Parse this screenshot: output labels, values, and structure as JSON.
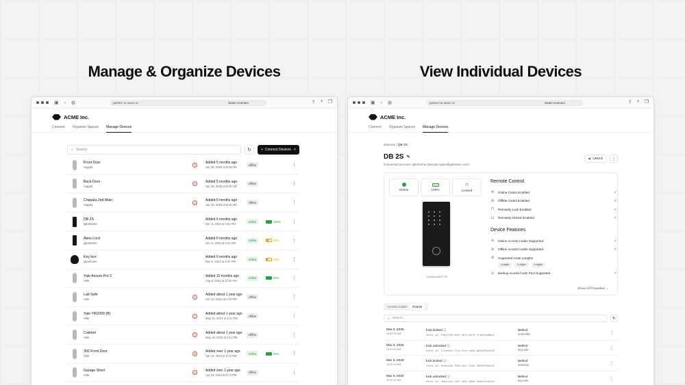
{
  "headlines": {
    "left": "Manage & Organize Devices",
    "right": "View Individual Devices"
  },
  "browser": {
    "url": "partner-ui.seam.vc",
    "tab": "Seam Connect"
  },
  "app": {
    "company": "ACME Inc.",
    "nav": [
      "Connect",
      "Organize Spaces",
      "Manage Devices"
    ],
    "active_nav": "Manage Devices"
  },
  "device_list": {
    "search_placeholder": "Search",
    "connect_label": "Connect Devices",
    "devices": [
      {
        "name": "Front Door",
        "brand": "August",
        "img": "keypad",
        "warn": true,
        "added": "Added 5 months ago",
        "date": "Jan 28, 2025 at 9:05 AM",
        "status": "offline",
        "battery": null
      },
      {
        "name": "Back Door",
        "brand": "August",
        "img": "keypad",
        "warn": true,
        "added": "Added 5 months ago",
        "date": "Jan 28, 2025 at 9:02 AM",
        "status": "offline",
        "battery": null
      },
      {
        "name": "Chapala 2nd Main",
        "brand": "August",
        "img": "keypad",
        "warn": true,
        "added": "Added 5 months ago",
        "date": "Jan 28, 2025 at 9:00 AM",
        "status": "offline",
        "battery": null
      },
      {
        "name": "DB 2S",
        "brand": "Igloohome",
        "img": "black",
        "warn": false,
        "added": "Added 6 months ago",
        "date": "Dec 6, 2024 at 4:01 PM",
        "status": "online",
        "battery": "100%",
        "battery_level": 1.0
      },
      {
        "name": "Abris Lock",
        "brand": "Igloohome",
        "img": "black",
        "warn": false,
        "added": "Added 6 months ago",
        "date": "Dec 6, 2024 at 4:01 PM",
        "status": "online",
        "battery": "40%",
        "battery_level": 0.4
      },
      {
        "name": "Key box",
        "brand": "Igloohome",
        "img": "padlock",
        "warn": false,
        "added": "Added 6 months ago",
        "date": "Dec 6, 2024 at 4:01 PM",
        "status": "online",
        "battery": "33%",
        "battery_level": 0.33
      },
      {
        "name": "Yale Assure Pro 2",
        "brand": "Yale",
        "img": "keypad",
        "warn": false,
        "added": "Added 10 months ago",
        "date": "Aug 5, 2024 at 11:00 AM",
        "status": "online",
        "battery": "96%",
        "battery_level": 0.96
      },
      {
        "name": "Lab Safe",
        "brand": "Yale",
        "img": "keypad",
        "warn": true,
        "added": "Added about 1 year ago",
        "date": "Jun 10, 2024 at 1:22 PM",
        "status": "offline",
        "battery": null
      },
      {
        "name": "Yale YRD256 (B)",
        "brand": "Yale",
        "img": "keypad",
        "warn": true,
        "added": "Added about 1 year ago",
        "date": "May 20, 2024 at 3:21 PM",
        "status": "offline",
        "battery": null
      },
      {
        "name": "Cabinet",
        "brand": "Yale",
        "img": "keypad",
        "warn": true,
        "added": "Added about 1 year ago",
        "date": "May 16, 2024 at 4:11 PM",
        "status": "offline",
        "battery": null
      },
      {
        "name": "302 Front Door",
        "brand": "Yale",
        "img": "keypad",
        "warn": true,
        "added": "Added over 1 year ago",
        "date": "Apr 19, 2024 at 6:12 PM",
        "status": "online",
        "battery": "96%",
        "battery_level": 0.96
      },
      {
        "name": "Garage Shed",
        "brand": "Yale",
        "img": "keypad",
        "warn": true,
        "added": "Added over 1 year ago",
        "date": "Apr 19, 2024 at 6:12 PM",
        "status": "offline",
        "battery": null
      }
    ]
  },
  "device_detail": {
    "crumb_parent": "Devices",
    "crumb_current": "DB 2S",
    "title": "DB 2S",
    "connected": "Connected account: Igloohome (devops+igloo@getseam.com)",
    "unlock_label": "Unlock",
    "stats": [
      {
        "label": "Online",
        "icon": "online-dot-icon"
      },
      {
        "label": "100%",
        "icon": "battery-icon"
      },
      {
        "label": "Locked",
        "icon": "lock-icon"
      }
    ],
    "serial": "DuAAUdeB2T7B",
    "remote_title": "Remote Control",
    "remote": [
      {
        "label": "Online Codes Enabled",
        "icon": "wifi-icon"
      },
      {
        "label": "Offline Codes Enabled",
        "icon": "wifi-off-icon"
      },
      {
        "label": "Remotely Lock Enabled",
        "icon": "lock-icon"
      },
      {
        "label": "Remotely Unlock Enabled",
        "icon": "unlock-icon"
      }
    ],
    "features_title": "Device Features",
    "features": [
      {
        "label": "Online Access Codes Supported",
        "icon": "wifi-icon",
        "check": true
      },
      {
        "label": "Offline Access Codes Supported",
        "icon": "wifi-off-icon",
        "check": true
      },
      {
        "label": "Supported Code Lengths",
        "icon": "code-length-icon",
        "check": false
      }
    ],
    "code_lengths": [
      "4-digits",
      "5-digits",
      "6-digits"
    ],
    "backup": {
      "label": "Backup Access Code Pool Supported",
      "icon": "backup-icon"
    },
    "show_all": "Show All Properties",
    "tabs": [
      "Access Codes",
      "Events"
    ],
    "active_tab": "Events",
    "events_search": "Search",
    "events": [
      {
        "date": "Mar 3, 2025",
        "time": "10:42:25 AM",
        "name": "lock.locked",
        "id": "event_id: 93b17226-4e62-487a-b079-1f4d81dd8bb2",
        "method_label": "Method",
        "method": "automatic"
      },
      {
        "date": "Mar 3, 2025",
        "time": "10:42:03 AM",
        "name": "lock.unlocked",
        "id": "event_id: 1fecdde4-1fca-4fcd-ad38-8644093cb538",
        "method_label": "Method",
        "method": "keycode"
      },
      {
        "date": "Mar 3, 2025",
        "time": "10:42:03 AM",
        "name": "lock.locked",
        "id": "event_id: 9c6e2a5b-79d0-44cc-818e-3894053a6ad3",
        "method_label": "Method",
        "method": "seamapi"
      },
      {
        "date": "Mar 3, 2025",
        "time": "10:42:03 AM",
        "name": "lock.unlocked",
        "id": "event_id: c6a1c1e4-c5f1-4d2e-8d3a-b5e6fa14e3c0",
        "method_label": "Method",
        "method": "keycode"
      }
    ]
  }
}
